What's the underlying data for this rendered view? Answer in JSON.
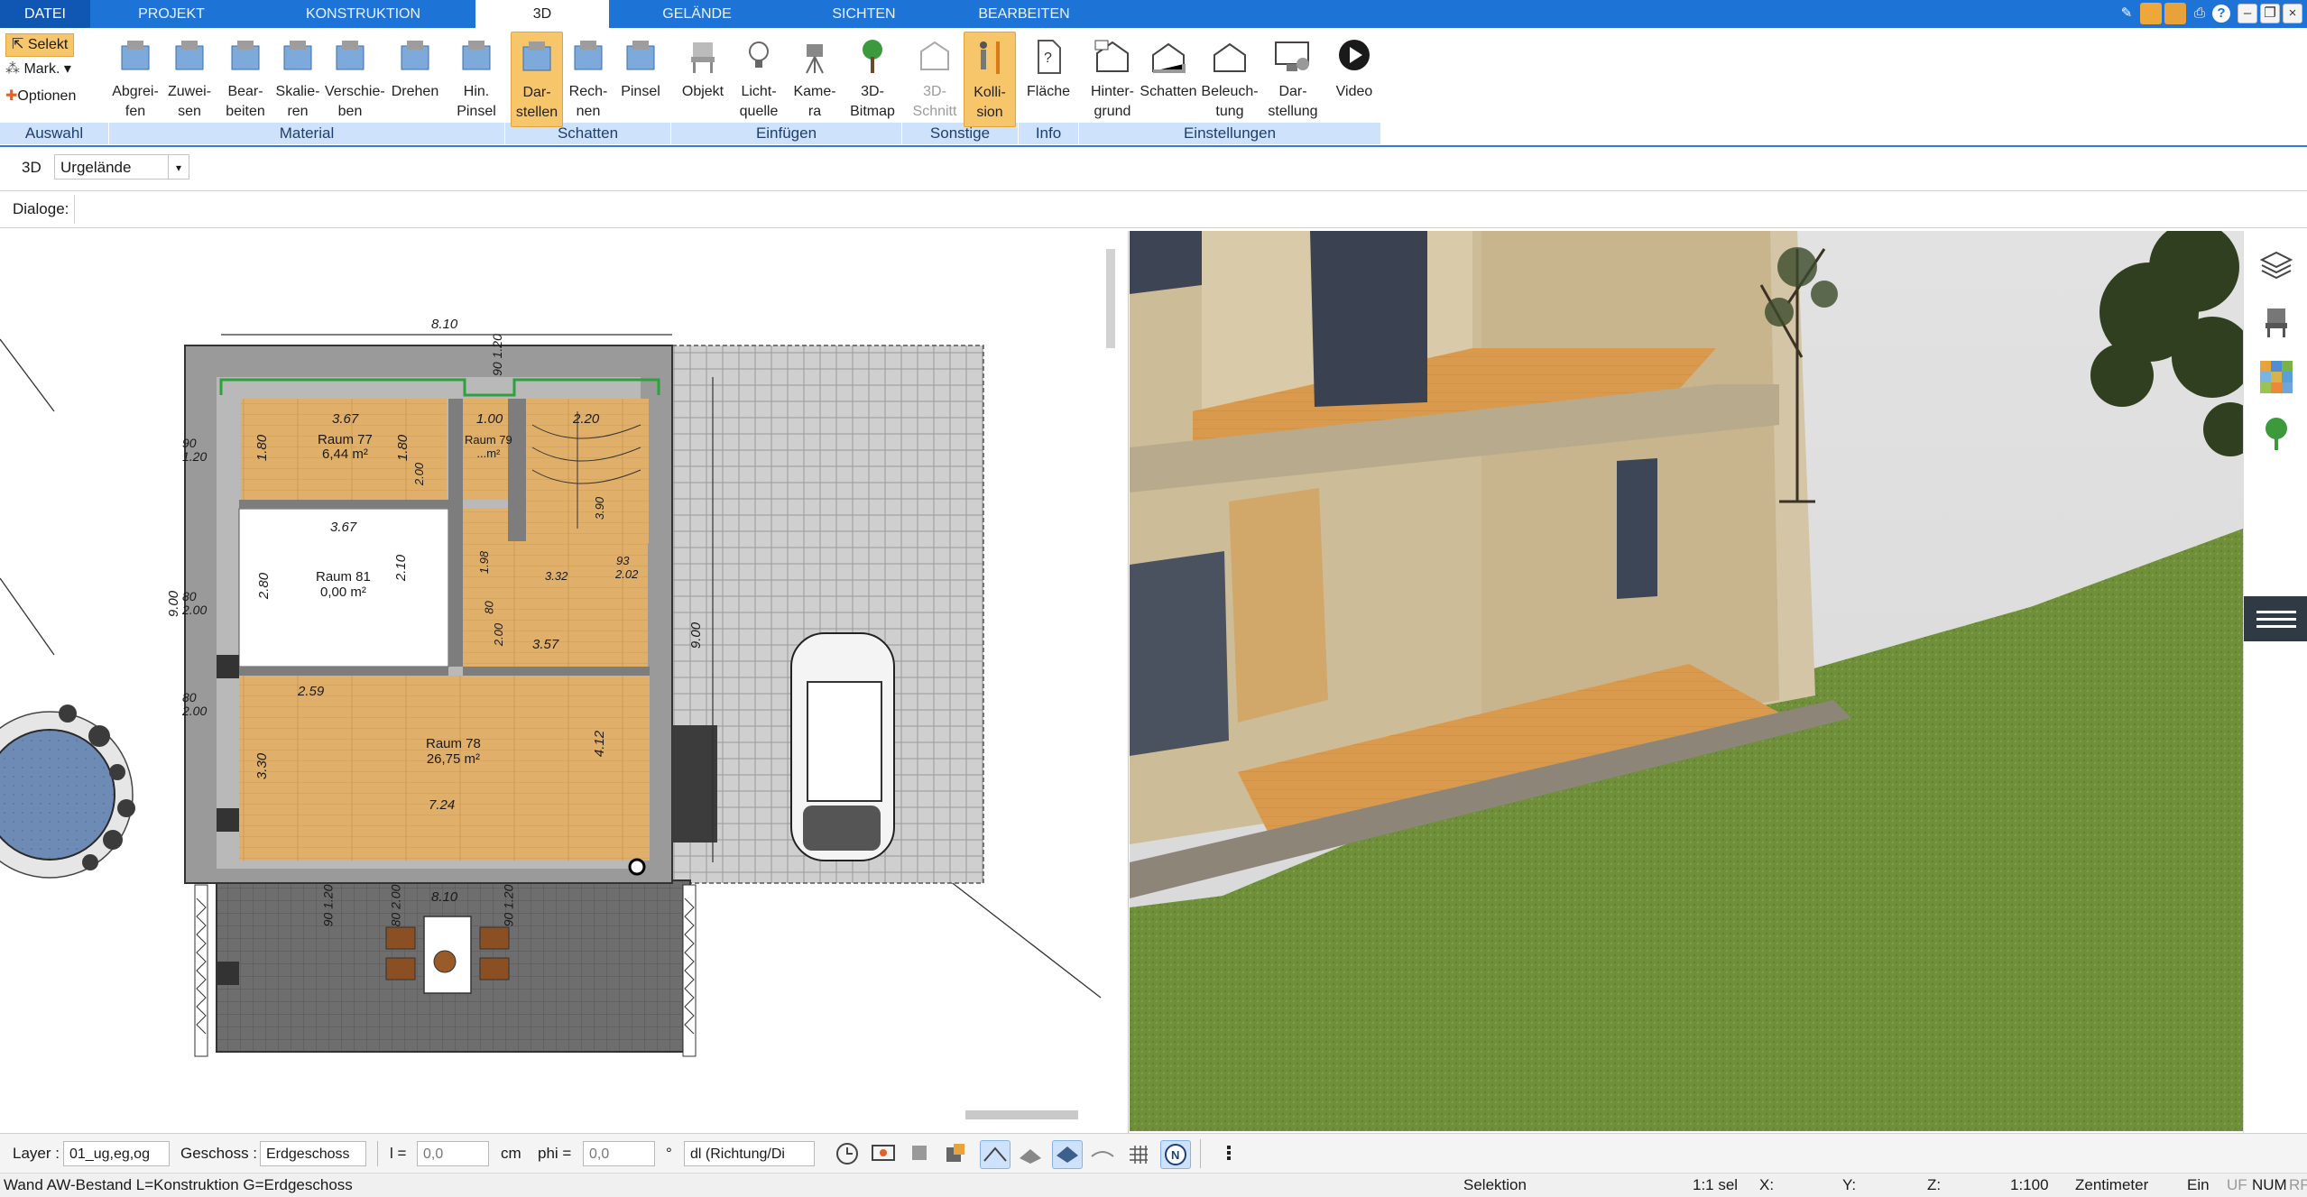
{
  "tabs": [
    {
      "label": "DATEI"
    },
    {
      "label": "PROJEKT"
    },
    {
      "label": "KONSTRUKTION"
    },
    {
      "label": "3D"
    },
    {
      "label": "GELÄNDE"
    },
    {
      "label": "SICHTEN"
    },
    {
      "label": "BEARBEITEN"
    }
  ],
  "ribbon": {
    "select": {
      "selekt": "Selekt",
      "mark": "Mark.",
      "optionen": "Optionen"
    },
    "material": [
      "Abgrei-\nfen",
      "Zuwei-\nsen",
      "Bear-\nbeiten",
      "Skalie-\nren",
      "Verschie-\nben",
      "Drehen",
      "Hin.\nPinsel"
    ],
    "schatten": [
      "Dar-\nstellen",
      "Rech-\nnen",
      "Pinsel"
    ],
    "einfuegen": [
      "Objekt",
      "Licht-\nquelle",
      "Kame-\nra",
      "3D-\nBitmap"
    ],
    "sonstige": [
      "3D-\nSchnitt",
      "Kolli-\nsion"
    ],
    "info": [
      "Fläche"
    ],
    "einstellungen": [
      "Hinter-\ngrund",
      "Schatten",
      "Beleuch-\ntung",
      "Dar-\nstellung",
      "Video"
    ],
    "groups": [
      "Auswahl",
      "Material",
      "Schatten",
      "Einfügen",
      "Sonstige",
      "Info",
      "Einstellungen"
    ]
  },
  "subbar": {
    "mode": "3D",
    "layer_select": "Urgelände"
  },
  "dialogbar": {
    "label": "Dialoge:"
  },
  "plan": {
    "dims": {
      "top_width": "8.10",
      "bottom_width": "8.10",
      "left_height": "9.00",
      "right_height": "9.00",
      "r77_w": "3.67",
      "r77_h": "1.80",
      "r77_h2": "1.80",
      "r79_w": "1.00",
      "stair_w": "2.20",
      "r81_w": "3.67",
      "r81_h": "2.80",
      "r81_h2": "2.10",
      "r78_w": "2.59",
      "r78_w2": "3.57",
      "r78_h": "3.30",
      "r78_h2": "4.12",
      "r78_w3": "7.24",
      "win_top_a": "90",
      "win_top_b": "1.20",
      "win_l1_a": "90",
      "win_l1_b": "1.20",
      "win_l2_a": "80",
      "win_l2_b": "2.00",
      "win_l3_a": "80",
      "win_l3_b": "2.00",
      "win_b1_a": "90",
      "win_b1_b": "1.20",
      "win_b2_a": "80",
      "win_b2_b": "2.00",
      "win_b3_a": "90",
      "win_b3_b": "1.20",
      "misc_1": "2.00",
      "misc_2": "80",
      "misc_3": "1.98",
      "misc_4": "3.32",
      "misc_5": "2.02",
      "misc_6": "93",
      "misc_7": "3.90",
      "misc_8": "2.00"
    },
    "rooms": [
      {
        "name": "Raum 77",
        "area": "6,44 m²"
      },
      {
        "name": "Raum 79",
        "area": "...m²"
      },
      {
        "name": "Raum 81",
        "area": "0,00 m²"
      },
      {
        "name": "Raum 78",
        "area": "26,75 m²"
      }
    ]
  },
  "bottombar": {
    "layer_label": "Layer :",
    "layer_value": "01_ug,eg,og",
    "geschoss_label": "Geschoss :",
    "geschoss_value": "Erdgeschoss",
    "l_label": "l =",
    "l_value": "0,0",
    "l_unit": "cm",
    "phi_label": "phi =",
    "phi_value": "0,0",
    "phi_unit": "°",
    "dl_value": "dl (Richtung/Di"
  },
  "status": {
    "left": "Wand AW-Bestand L=Konstruktion G=Erdgeschoss",
    "mode": "Selektion",
    "sel": "1:1 sel",
    "x": "X:",
    "y": "Y:",
    "z": "Z:",
    "scale": "1:100",
    "unit": "Zentimeter",
    "ein": "Ein",
    "uf": "UF",
    "num": "NUM",
    "rf": "RF"
  },
  "colors": {
    "tab_blue": "#1e73d6",
    "ribbon_group": "#cfe2fb",
    "active_button": "#f7c56a"
  }
}
